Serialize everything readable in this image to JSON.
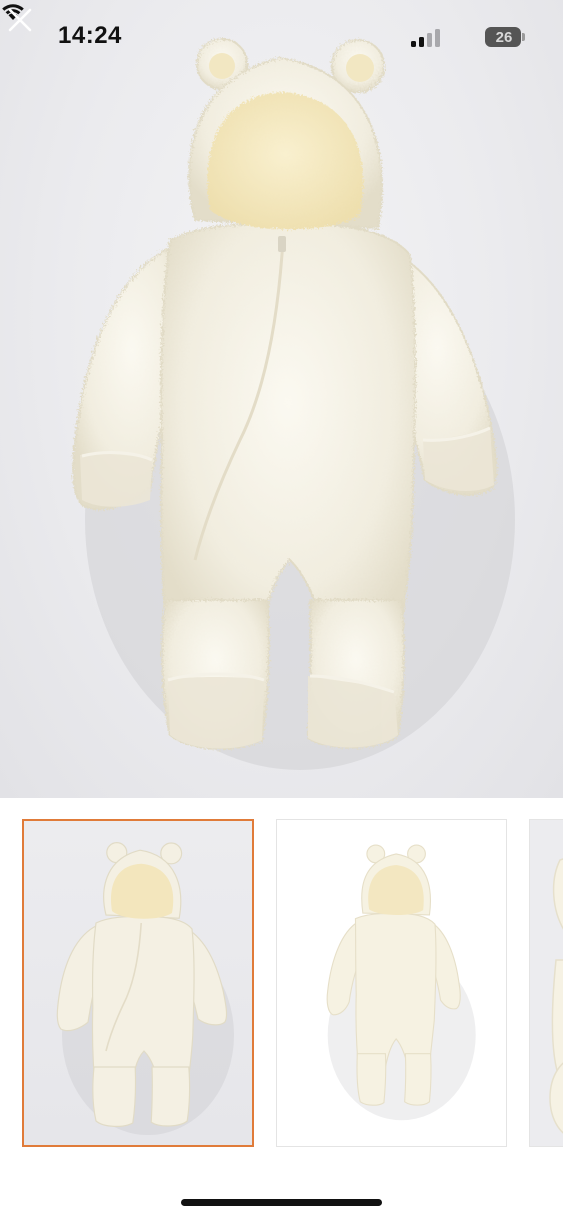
{
  "status_bar": {
    "time": "14:24",
    "battery_level": "26",
    "icons": [
      "cellular-signal-icon",
      "wifi-icon",
      "battery-icon"
    ]
  },
  "viewer": {
    "close_icon": "close-icon",
    "main_image_alt": "",
    "selected_thumbnail_index": 0
  },
  "thumbnails": [
    {
      "selected": true
    },
    {
      "selected": false
    },
    {
      "selected": false
    }
  ],
  "colors": {
    "selected_border": "#e07b39",
    "garment": "#f7f3e6",
    "lining": "#f5ecc8"
  }
}
